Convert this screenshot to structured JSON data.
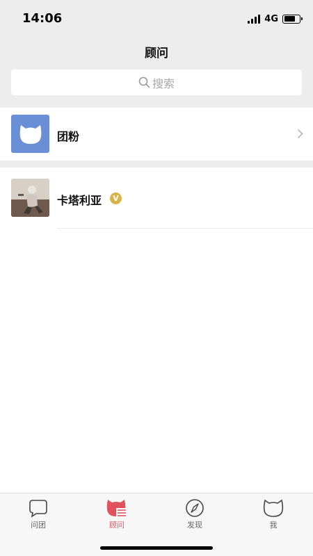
{
  "status_bar": {
    "time": "14:06",
    "network": "4G"
  },
  "header": {
    "title": "顾问"
  },
  "search": {
    "placeholder": "搜索"
  },
  "list": {
    "items": [
      {
        "label": "团粉",
        "icon": "cat-face-icon",
        "has_chevron": true
      },
      {
        "label": "卡塔利亚",
        "badge": "V",
        "badge_color": "#d9b347"
      }
    ]
  },
  "tab_bar": {
    "tabs": [
      {
        "label": "问团",
        "icon": "chat-bubble-icon",
        "active": false
      },
      {
        "label": "顾问",
        "icon": "cat-list-icon",
        "active": true
      },
      {
        "label": "发现",
        "icon": "compass-icon",
        "active": false
      },
      {
        "label": "我",
        "icon": "cat-outline-icon",
        "active": false
      }
    ],
    "active_color": "#e0525e"
  },
  "colors": {
    "header_bg": "#ededed",
    "fans_avatar_bg": "#6a8fd6"
  }
}
